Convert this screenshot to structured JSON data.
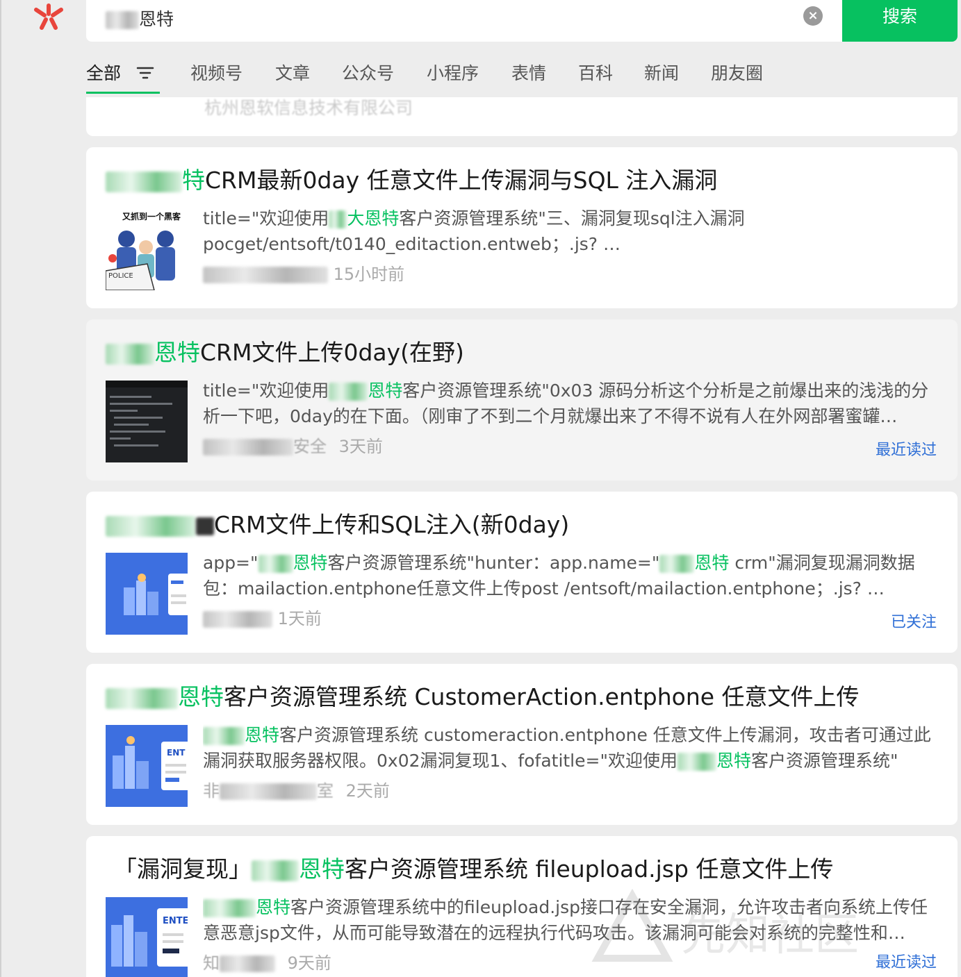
{
  "search": {
    "query": "恩特",
    "button_label": "搜索",
    "clear_icon": "close-circle-icon"
  },
  "tabs": [
    {
      "label": "全部",
      "active": true
    },
    {
      "label": "视频号"
    },
    {
      "label": "文章"
    },
    {
      "label": "公众号"
    },
    {
      "label": "小程序"
    },
    {
      "label": "表情"
    },
    {
      "label": "百科"
    },
    {
      "label": "新闻"
    },
    {
      "label": "朋友圈"
    }
  ],
  "previous_result": {
    "source": "杭州恩软信息技术有限公司"
  },
  "results": [
    {
      "title_pre": "",
      "title_hl": "特",
      "title_rest": "CRM最新0day 任意文件上传漏洞与SQL 注入漏洞",
      "snippet_a": "title=\"欢迎使用",
      "snippet_hl": "大恩特",
      "snippet_b": "客户资源管理系统\"三、漏洞复现sql注入漏洞pocget/entsoft/t0140_editaction.entweb；.js? …",
      "time": "15小时前",
      "tag": "",
      "thumb_text": "又抓到一个黑客"
    },
    {
      "title_pre": "",
      "title_hl": "恩特",
      "title_rest": "CRM文件上传0day(在野)",
      "snippet_a": "title=\"欢迎使用",
      "snippet_hl": "恩特",
      "snippet_b": "客户资源管理系统\"0x03 源码分析这个分析是之前爆出来的浅浅的分析一下吧，0day的在下面。（刚审了不到二个月就爆出来了不得不说有人在外网部署蜜罐…",
      "time": "3天前",
      "source_tail": "安全",
      "tag": "最近读过"
    },
    {
      "title_pre": "",
      "title_hl": "",
      "title_rest": "CRM文件上传和SQL注入(新0day)",
      "snippet_a": "app=\"",
      "snippet_hl": "恩特",
      "snippet_b": "客户资源管理系统\"hunter：app.name=\"",
      "snippet_hl2": "恩特",
      "snippet_c": " crm\"漏洞复现漏洞数据包：mailaction.entphone任意文件上传post /entsoft/mailaction.entphone；.js? …",
      "time": "1天前",
      "tag": "已关注"
    },
    {
      "title_pre": "",
      "title_hl": "恩特",
      "title_rest": "客户资源管理系统 CustomerAction.entphone 任意文件上传",
      "snippet_a": "",
      "snippet_hl": "恩特",
      "snippet_b": "客户资源管理系统 customeraction.entphone 任意文件上传漏洞，攻击者可通过此漏洞获取服务器权限。0x02漏洞复现1、fofatitle=\"欢迎使用",
      "snippet_hl2": "恩特",
      "snippet_c": "客户资源管理系统\"",
      "time": "2天前",
      "source_head": "非",
      "source_tail": "室",
      "tag": ""
    },
    {
      "title_pre": "「漏洞复现」",
      "title_hl": "恩特",
      "title_rest": "客户资源管理系统 fileupload.jsp 任意文件上传",
      "snippet_a": "",
      "snippet_hl": "恩特",
      "snippet_b": "客户资源管理系统中的fileupload.jsp接口存在安全漏洞，允许攻击者向系统上传任意恶意jsp文件，从而可能导致潜在的远程执行代码攻击。该漏洞可能会对系统的完整性和…",
      "time": "9天前",
      "source_head": "知",
      "tag": "最近读过"
    }
  ],
  "watermark": "先知社区",
  "colors": {
    "accent_green": "#07c160",
    "link_blue": "#2f6fd6",
    "background": "#ededed"
  }
}
